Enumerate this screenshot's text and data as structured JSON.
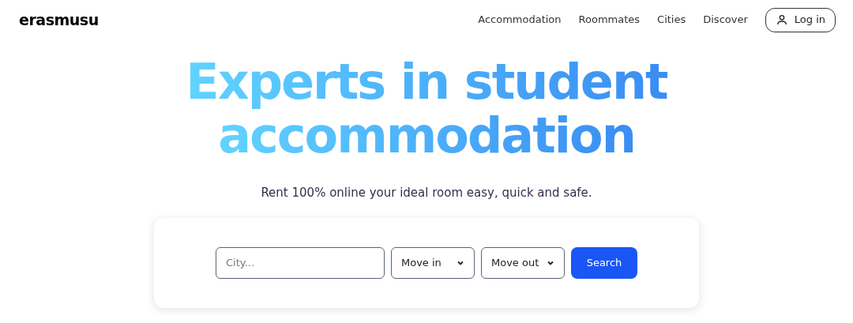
{
  "header": {
    "logo": "erasmusu",
    "nav": [
      "Accommodation",
      "Roommates",
      "Cities",
      "Discover"
    ],
    "login": "Log in"
  },
  "hero": {
    "title_lines": [
      "Experts in student",
      "accommodation"
    ],
    "subtitle": "Rent 100% online your ideal room easy, quick and safe."
  },
  "search": {
    "city": {
      "placeholder": "City..."
    },
    "selects": [
      "Move in",
      "Move out"
    ],
    "button": "Search"
  }
}
